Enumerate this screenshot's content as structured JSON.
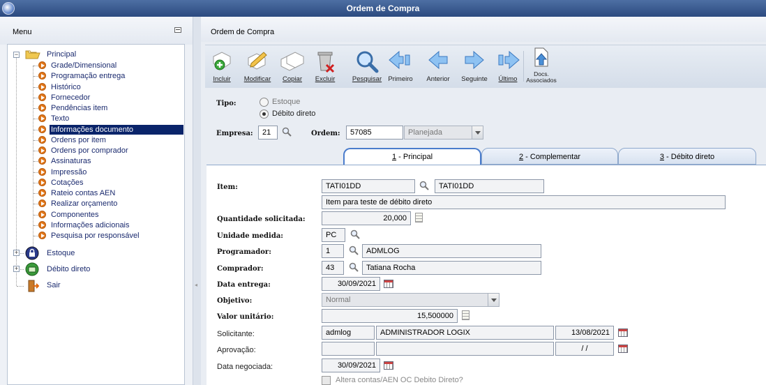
{
  "window": {
    "title": "Ordem de Compra"
  },
  "menu": {
    "header": "Menu",
    "root": "Principal",
    "items": [
      "Grade/Dimensional",
      "Programação entrega",
      "Histórico",
      "Fornecedor",
      "Pendências item",
      "Texto",
      "Informações documento",
      "Ordens por item",
      "Ordens por comprador",
      "Assinaturas",
      "Impressão",
      "Cotações",
      "Rateio contas AEN",
      "Realizar orçamento",
      "Componentes",
      "Informações adicionais",
      "Pesquisa por responsável"
    ],
    "selected_index": 6,
    "groups": [
      "Estoque",
      "Débito direto"
    ],
    "exit": "Sair"
  },
  "panel_title": "Ordem de Compra",
  "toolbar": {
    "incluir": "Incluir",
    "modificar": "Modificar",
    "copiar": "Copiar",
    "excluir": "Excluir",
    "pesquisar": "Pesquisar",
    "primeiro": "Primeiro",
    "anterior": "Anterior",
    "seguinte": "Seguinte",
    "ultimo": "Último",
    "docs1": "Docs.",
    "docs2": "Associados"
  },
  "header_form": {
    "tipo_label": "Tipo:",
    "tipo_options": [
      "Estoque",
      "Débito direto"
    ],
    "tipo_selected": "Débito direto",
    "empresa_label": "Empresa:",
    "empresa": "21",
    "ordem_label": "Ordem:",
    "ordem": "57085",
    "status": "Planejada"
  },
  "tabs": [
    "1 - Principal",
    "2 - Complementar",
    "3 - Débito direto"
  ],
  "active_tab": "1 - Principal",
  "form": {
    "item_label": "Item:",
    "item_code": "TATI01DD",
    "item_code2": "TATI01DD",
    "item_desc": "Item para teste de débito direto",
    "qtd_label": "Quantidade solicitada:",
    "qtd": "20,000",
    "unidade_label": "Unidade medida:",
    "unidade": "PC",
    "programador_label": "Programador:",
    "programador_cod": "1",
    "programador_nome": "ADMLOG",
    "comprador_label": "Comprador:",
    "comprador_cod": "43",
    "comprador_nome": "Tatiana Rocha",
    "data_entrega_label": "Data entrega:",
    "data_entrega": "30/09/2021",
    "objetivo_label": "Objetivo:",
    "objetivo": "Normal",
    "valor_label": "Valor unitário:",
    "valor": "15,500000",
    "solicitante_label": "Solicitante:",
    "solicitante_user": "admlog",
    "solicitante_nome": "ADMINISTRADOR LOGIX",
    "solicitante_data": "13/08/2021",
    "aprovacao_label": "Aprovação:",
    "aprovacao_data": " / /",
    "data_neg_label": "Data negociada:",
    "data_neg": "30/09/2021",
    "altera_label": "Altera contas/AEN OC Debito Direto?"
  }
}
